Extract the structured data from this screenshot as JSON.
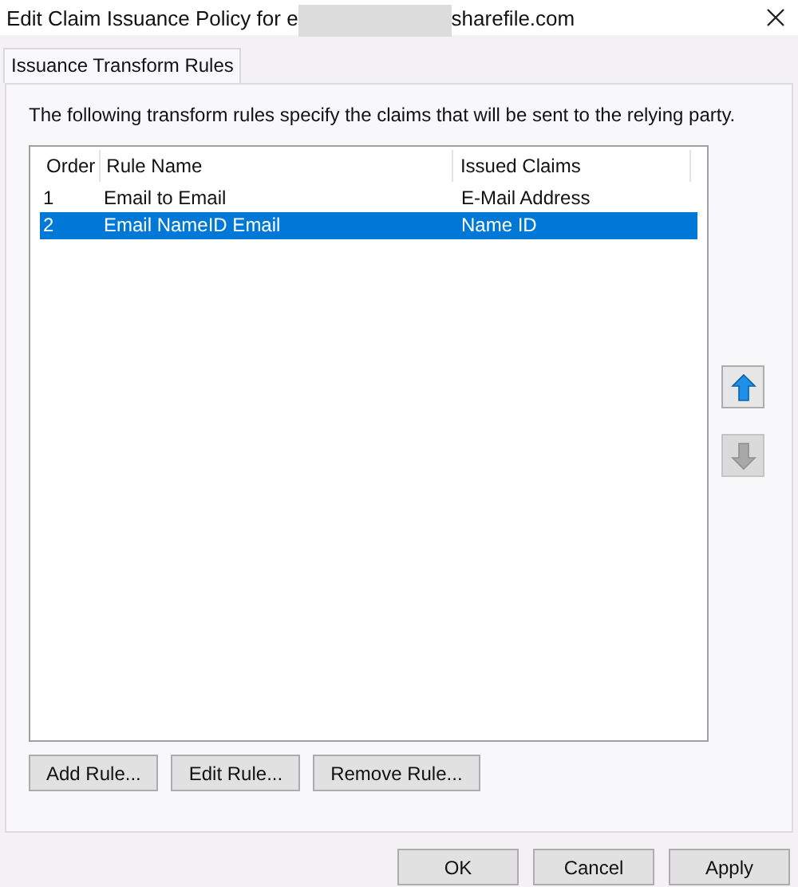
{
  "window": {
    "title_start": "Edit Claim Issuance Policy for e",
    "title_end": "sharefile.com"
  },
  "tabs": [
    {
      "label": "Issuance Transform Rules",
      "selected": true
    }
  ],
  "description": "The following transform rules specify the claims that will be sent to the relying party.",
  "table": {
    "columns": [
      "Order",
      "Rule Name",
      "Issued Claims"
    ],
    "rows": [
      {
        "cells": [
          "1",
          "Email to Email",
          "E-Mail Address"
        ],
        "selected": false
      },
      {
        "cells": [
          "2",
          "Email NameID Email",
          "Name ID"
        ],
        "selected": true
      }
    ]
  },
  "move_buttons": [
    {
      "kind": "up",
      "disabled": false
    },
    {
      "kind": "down",
      "disabled": true
    }
  ],
  "rule_buttons": [
    "Add Rule...",
    "Edit Rule...",
    "Remove Rule..."
  ],
  "dialog_buttons": [
    "OK",
    "Cancel",
    "Apply"
  ]
}
